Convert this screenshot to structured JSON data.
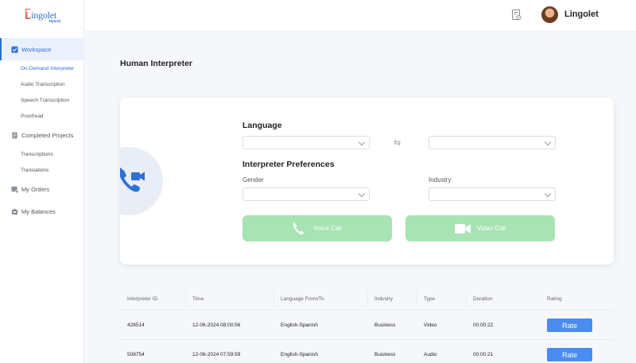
{
  "brand": {
    "logo_text_1": "L",
    "logo_text_2": "ingolet",
    "logo_sub": "Hybrid"
  },
  "sidebar": {
    "workspace": "Workspace",
    "items": [
      "On-Demand Interpreter",
      "Audio Transcription",
      "Speech Transcription",
      "Proofread"
    ],
    "completed": "Completed Projects",
    "completed_items": [
      "Transcriptions",
      "Translations"
    ],
    "orders": "My Orders",
    "balances": "My Balances"
  },
  "header": {
    "user_name": "Lingolet"
  },
  "page": {
    "title": "Human Interpreter"
  },
  "form": {
    "language_title": "Language",
    "prefs_title": "Interpreter Preferences",
    "gender_label": "Gender",
    "industry_label": "Industry",
    "swap_symbol": "⇆",
    "voice_call": "Voice Call",
    "video_call": "Video Call"
  },
  "table": {
    "headers": [
      "Interpreter ID",
      "Time",
      "Language From/To",
      "Industry",
      "Type",
      "Duration",
      "Rating"
    ],
    "rows": [
      {
        "id": "428514",
        "time": "12-06-2024 08:00:56",
        "lang": "English-Spanish",
        "industry": "Business",
        "type": "Video",
        "duration": "00:00:22",
        "rate": "Rate"
      },
      {
        "id": "508754",
        "time": "12-06-2024 07:59:59",
        "lang": "English-Spanish",
        "industry": "Business",
        "type": "Audio",
        "duration": "00:00:21",
        "rate": "Rate"
      }
    ]
  },
  "colors": {
    "accent": "#2e6fd8",
    "call_green": "#a8e3b3",
    "rate_blue": "#4a8cf0"
  }
}
